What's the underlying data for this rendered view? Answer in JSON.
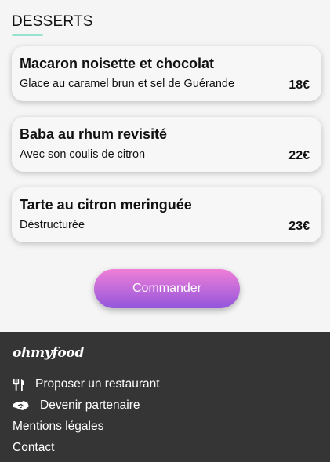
{
  "section": {
    "title": "DESSERTS"
  },
  "desserts": [
    {
      "name": "Macaron noisette et chocolat",
      "description": "Glace au caramel brun et sel de Guérande",
      "price": "18€"
    },
    {
      "name": "Baba au rhum revisité",
      "description": "Avec son coulis de citron",
      "price": "22€"
    },
    {
      "name": "Tarte au citron meringuée",
      "description": "Déstructurée",
      "price": "23€"
    }
  ],
  "order_button": {
    "label": "Commander"
  },
  "footer": {
    "logo": "ohmyfood",
    "links": [
      {
        "label": "Proposer un restaurant",
        "icon": "utensils-icon"
      },
      {
        "label": "Devenir partenaire",
        "icon": "handshake-icon"
      },
      {
        "label": "Mentions légales"
      },
      {
        "label": "Contact"
      }
    ]
  },
  "colors": {
    "accent_underline": "#99e2d0",
    "button_gradient_top": "#f07fd8",
    "button_gradient_bottom": "#9356dc",
    "footer_bg": "#353535"
  }
}
